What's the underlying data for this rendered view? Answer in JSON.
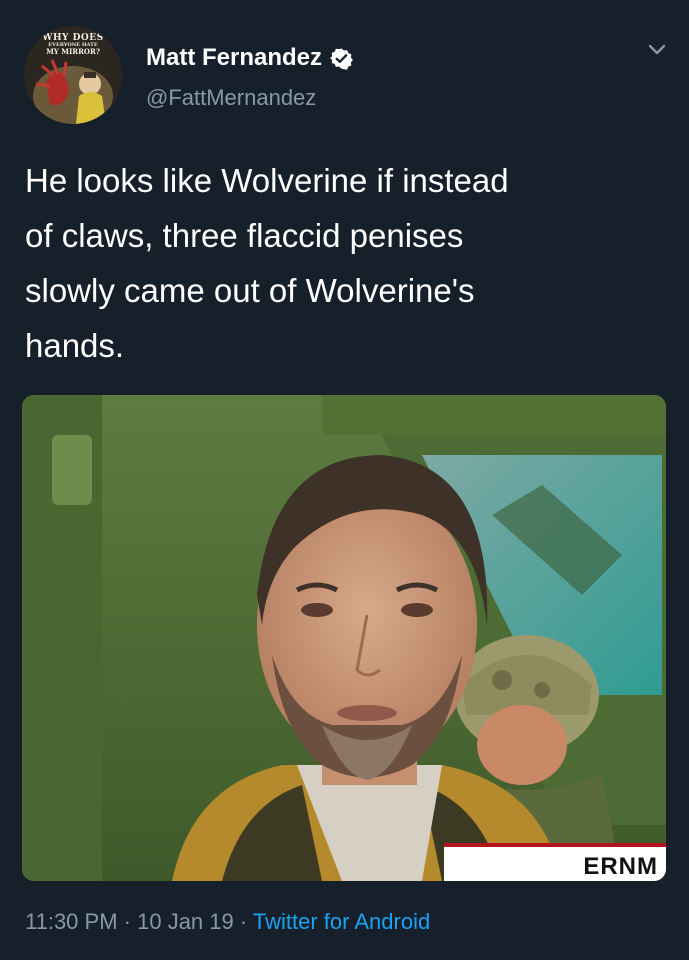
{
  "author": {
    "display_name": "Matt Fernandez",
    "handle": "@FattMernandez",
    "verified": true,
    "avatar_text": {
      "line1": "WHY DOES",
      "line2": "EVERYONE HATE",
      "line3": "MY MIRROR?"
    }
  },
  "tweet": {
    "text": "He looks like Wolverine if instead\nof claws, three flaccid penises\nslowly came out of Wolverine's\nhands."
  },
  "media": {
    "chyron_text": "ERNM"
  },
  "meta": {
    "time": "11:30 PM",
    "separator": " · ",
    "date": "10 Jan 19",
    "source": "Twitter for Android"
  },
  "icons": {
    "verified": "verified-badge-icon",
    "menu": "chevron-down-icon"
  },
  "colors": {
    "background": "#15202b",
    "text_primary": "#ffffff",
    "text_secondary": "#8899a6",
    "link": "#1da1f2"
  }
}
